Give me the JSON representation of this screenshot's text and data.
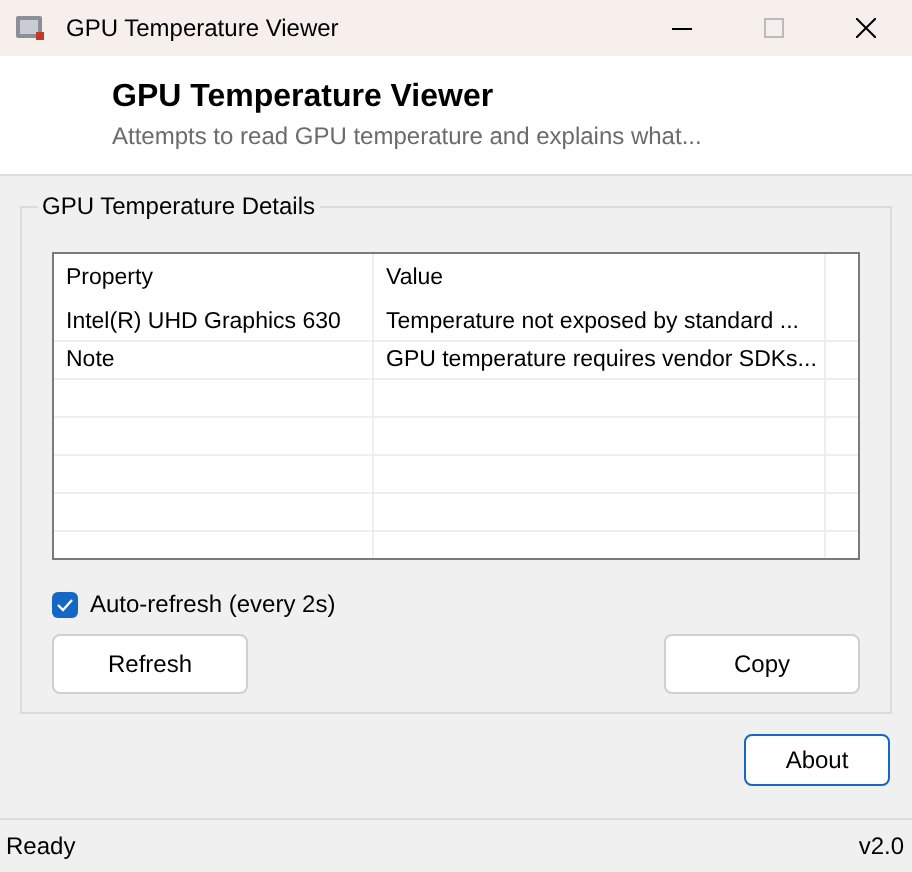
{
  "window": {
    "title": "GPU Temperature Viewer"
  },
  "header": {
    "title": "GPU Temperature Viewer",
    "subtitle": "Attempts to read GPU temperature and explains what..."
  },
  "group": {
    "title": "GPU Temperature Details",
    "table": {
      "columns": [
        "Property",
        "Value"
      ],
      "rows": [
        {
          "cells": [
            "Intel(R) UHD Graphics 630",
            "Temperature not exposed by standard ..."
          ]
        },
        {
          "cells": [
            "Note",
            "GPU temperature requires vendor SDKs..."
          ]
        }
      ]
    },
    "auto_refresh": {
      "label": "Auto-refresh (every 2s)",
      "checked": true
    },
    "buttons": [
      {
        "label": "Refresh",
        "default": false
      },
      {
        "label": "Copy",
        "default": false
      }
    ]
  },
  "about_button": {
    "label": "About",
    "default": true
  },
  "status_bar": {
    "text": "Ready",
    "version": "v2.0"
  }
}
